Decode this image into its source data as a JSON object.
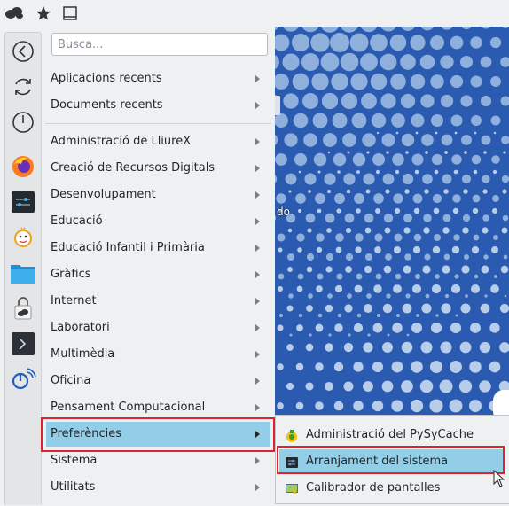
{
  "search": {
    "placeholder": "Busca..."
  },
  "toolbar": {
    "icons": [
      "user-avatar-icon",
      "favorites-star-icon",
      "window-icon"
    ]
  },
  "favorites": [
    {
      "icon": "back-arrow-icon"
    },
    {
      "icon": "refresh-icon"
    },
    {
      "icon": "power-icon"
    },
    {
      "icon": "firefox-icon"
    },
    {
      "icon": "settings-sliders-icon"
    },
    {
      "icon": "sun-face-icon"
    },
    {
      "icon": "folder-icon"
    },
    {
      "icon": "lock-cloud-icon"
    },
    {
      "icon": "terminal-icon"
    },
    {
      "icon": "remote-access-icon"
    }
  ],
  "menu": {
    "recent": [
      {
        "label": "Aplicacions recents"
      },
      {
        "label": "Documents recents"
      }
    ],
    "categories": [
      {
        "label": "Administració de LliureX"
      },
      {
        "label": "Creació de Recursos Digitals"
      },
      {
        "label": "Desenvolupament"
      },
      {
        "label": "Educació"
      },
      {
        "label": "Educació Infantil i Primària"
      },
      {
        "label": "Gràfics"
      },
      {
        "label": "Internet"
      },
      {
        "label": "Laboratori"
      },
      {
        "label": "Multimèdia"
      },
      {
        "label": "Oficina"
      },
      {
        "label": "Pensament Computacional"
      },
      {
        "label": "Preferències"
      },
      {
        "label": "Sistema"
      },
      {
        "label": "Utilitats"
      }
    ]
  },
  "submenu": {
    "items": [
      {
        "label": "Administració del PySyCache",
        "icon": "pysycache-icon"
      },
      {
        "label": "Arranjament del sistema",
        "icon": "system-settings-icon"
      },
      {
        "label": "Calibrador de pantalles",
        "icon": "screen-calibrator-icon"
      }
    ]
  },
  "desktop": {
    "partial_label": "do"
  },
  "colors": {
    "highlight": "#93cee9",
    "annotation": "#e0212f",
    "wallpaper": "#2a5bb0"
  }
}
